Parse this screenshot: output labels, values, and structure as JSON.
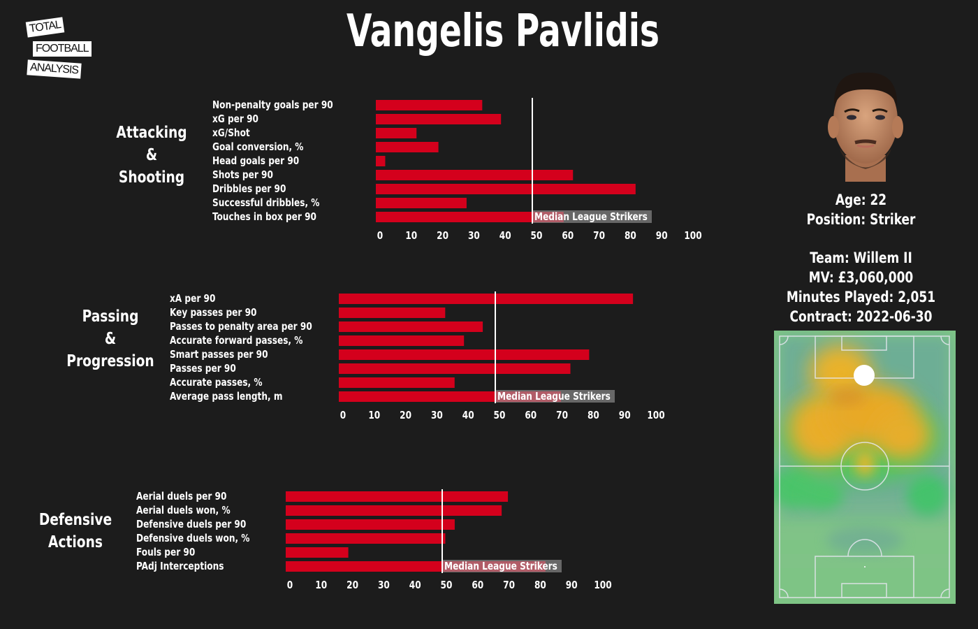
{
  "logo": {
    "line1": "TOTAL",
    "line2": "FOOTBALL",
    "line3": "ANALYSIS"
  },
  "title": "Vangelis Pavlidis",
  "colors": {
    "background": "#1c1c1c",
    "bar": "#d4001c",
    "median_line": "#ffffff",
    "label_box": "#9a9a9a",
    "text": "#ffffff"
  },
  "player": {
    "photo_alt": "player-headshot",
    "age_line": "Age: 22",
    "position_line": "Position: Striker",
    "team_line": "Team: Willem II",
    "mv_line": "MV: £3,060,000",
    "minutes_line": "Minutes Played: 2,051",
    "contract_line": "Contract: 2022-06-30"
  },
  "heatmap": {
    "description": "Player touch heatmap on vertical pitch, attacking upward",
    "hotspots": [
      "left half-space in final third",
      "centre of opponent half",
      "centre circle"
    ]
  },
  "chart_data": [
    {
      "type": "bar",
      "orientation": "horizontal",
      "section_label": [
        "Attacking",
        "&",
        "Shooting"
      ],
      "categories": [
        "Non-penalty goals per 90",
        "xG per 90",
        "xG/Shot",
        "Goal conversion, %",
        "Head goals per 90",
        "Shots per 90",
        "Dribbles per 90",
        "Successful dribbles, %",
        "Touches in box per 90"
      ],
      "values": [
        34,
        40,
        13,
        20,
        3,
        63,
        83,
        29,
        60
      ],
      "xlim": [
        0,
        100
      ],
      "xticks": [
        "0",
        "10",
        "20",
        "30",
        "40",
        "50",
        "60",
        "70",
        "80",
        "90",
        "100"
      ],
      "median": 50,
      "median_label": "Median League Strikers",
      "xlabel": "",
      "ylabel": ""
    },
    {
      "type": "bar",
      "orientation": "horizontal",
      "section_label": [
        "Passing",
        "&",
        "Progression"
      ],
      "categories": [
        "xA per 90",
        "Key passes per 90",
        "Passes to penalty area per 90",
        "Accurate forward passes, %",
        "Smart passes per 90",
        "Passes per 90",
        "Accurate passes, %",
        "Average pass length, m"
      ],
      "values": [
        94,
        34,
        46,
        40,
        80,
        74,
        37,
        71
      ],
      "xlim": [
        0,
        100
      ],
      "xticks": [
        "0",
        "10",
        "20",
        "30",
        "40",
        "50",
        "60",
        "70",
        "80",
        "90",
        "100"
      ],
      "median": 50,
      "median_label": "Median League Strikers",
      "xlabel": "",
      "ylabel": ""
    },
    {
      "type": "bar",
      "orientation": "horizontal",
      "section_label": [
        "Defensive",
        "Actions"
      ],
      "categories": [
        "Aerial duels per 90",
        "Aerial duels won, %",
        "Defensive duels per 90",
        "Defensive duels won, %",
        "Fouls per 90",
        "PAdj Interceptions"
      ],
      "values": [
        71,
        69,
        54,
        51,
        20,
        83
      ],
      "xlim": [
        0,
        100
      ],
      "xticks": [
        "0",
        "10",
        "20",
        "30",
        "40",
        "50",
        "60",
        "70",
        "80",
        "90",
        "100"
      ],
      "median": 50,
      "median_label": "Median League Strikers",
      "xlabel": "",
      "ylabel": ""
    }
  ]
}
